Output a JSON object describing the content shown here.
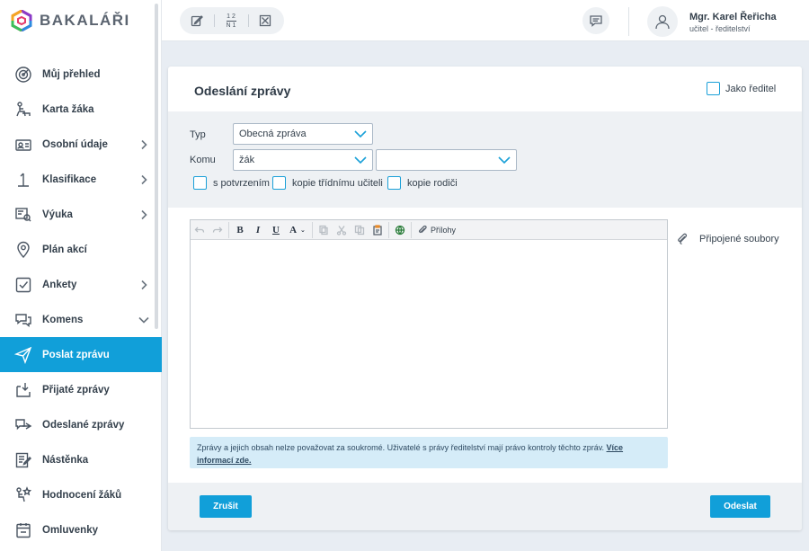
{
  "app": {
    "brand": "BAKALÁŘI"
  },
  "topbar": {
    "tools": [
      "edit-icon",
      "fraction-icon",
      "close-box-icon"
    ],
    "fraction_top": "1 2",
    "fraction_bottom": "N 1",
    "user": {
      "name": "Mgr. Karel Řeřicha",
      "role": "učitel - ředitelství"
    }
  },
  "sidebar": {
    "items": [
      {
        "label": "Můj přehled",
        "icon": "dashboard-icon",
        "chevron": ""
      },
      {
        "label": "Karta žáka",
        "icon": "student-icon",
        "chevron": ""
      },
      {
        "label": "Osobní údaje",
        "icon": "personal-data-icon",
        "chevron": "right"
      },
      {
        "label": "Klasifikace",
        "icon": "grade-icon",
        "chevron": "right"
      },
      {
        "label": "Výuka",
        "icon": "teaching-icon",
        "chevron": "right"
      },
      {
        "label": "Plán akcí",
        "icon": "location-icon",
        "chevron": ""
      },
      {
        "label": "Ankety",
        "icon": "survey-icon",
        "chevron": "right"
      },
      {
        "label": "Komens",
        "icon": "messages-icon",
        "chevron": "down"
      },
      {
        "label": "Poslat zprávu",
        "icon": "send-icon",
        "chevron": "",
        "active": true
      },
      {
        "label": "Přijaté zprávy",
        "icon": "inbox-icon",
        "chevron": ""
      },
      {
        "label": "Odeslané zprávy",
        "icon": "sent-icon",
        "chevron": ""
      },
      {
        "label": "Nástěnka",
        "icon": "noticeboard-icon",
        "chevron": ""
      },
      {
        "label": "Hodnocení žáků",
        "icon": "evaluation-icon",
        "chevron": ""
      },
      {
        "label": "Omluvenky",
        "icon": "excuse-icon",
        "chevron": ""
      }
    ]
  },
  "form": {
    "title": "Odeslání zprávy",
    "as_director": "Jako ředitel",
    "type_label": "Typ",
    "type_value": "Obecná zpráva",
    "to_label": "Komu",
    "to_value": "žák",
    "to_value2": "",
    "options": [
      "s potvrzením",
      "kopie třídnímu učiteli",
      "kopie rodiči"
    ],
    "attachments_btn": "Přílohy",
    "attached_files": "Připojené soubory",
    "notice_text": "Zprávy a jejich obsah nelze považovat za soukromé. Uživatelé s právy ředitelství mají právo kontroly těchto zpráv. ",
    "notice_link": "Více informací zde.",
    "cancel": "Zrušit",
    "send": "Odeslat"
  },
  "colors": {
    "accent": "#119fd9",
    "checkbox": "#1aa0d8",
    "notice_bg": "#d5ecf8"
  }
}
